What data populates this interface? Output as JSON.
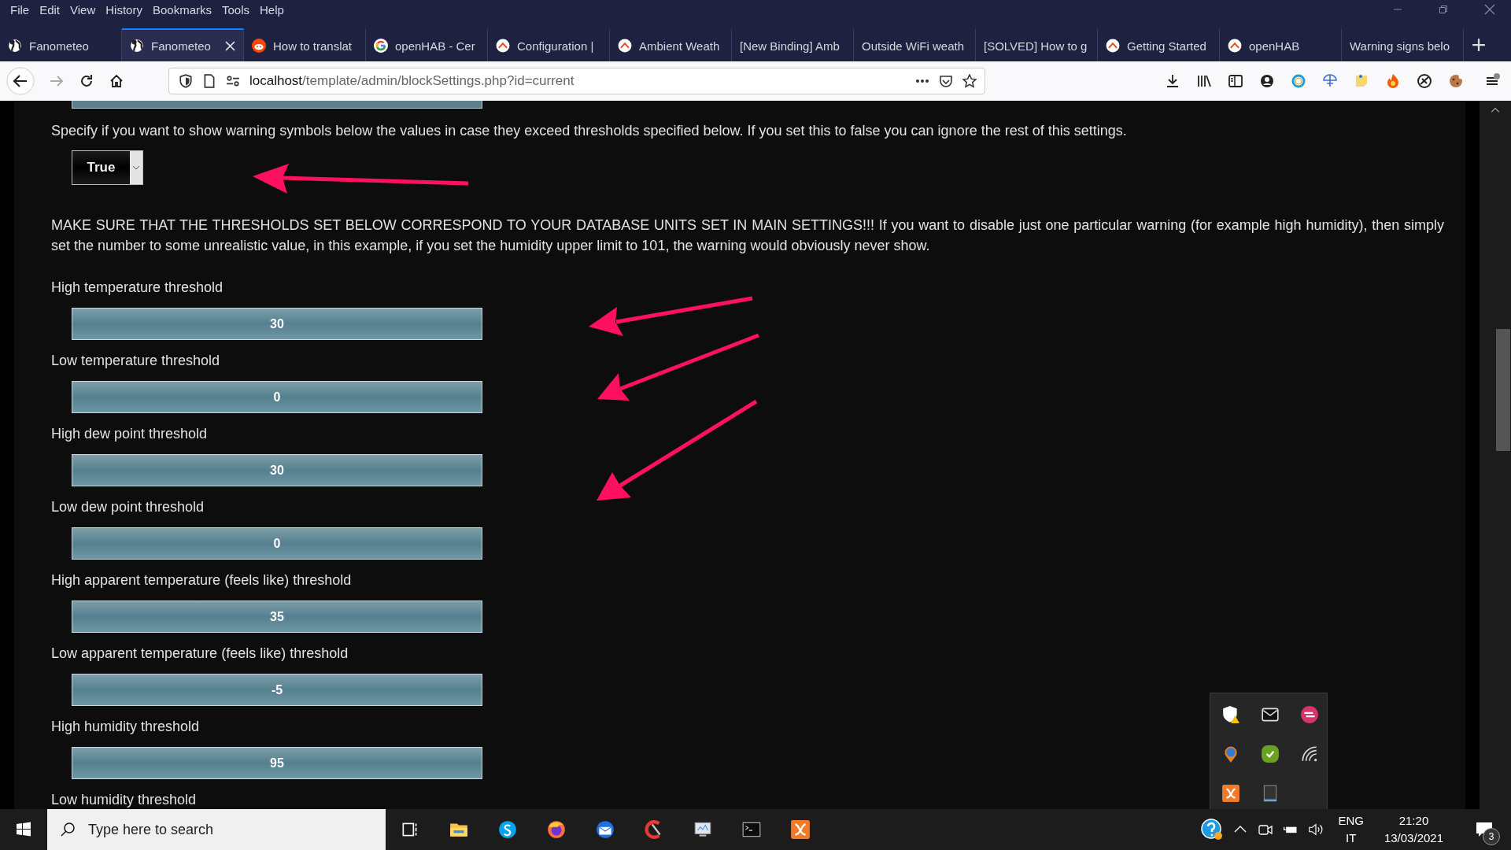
{
  "menu": [
    "File",
    "Edit",
    "View",
    "History",
    "Bookmarks",
    "Tools",
    "Help"
  ],
  "tabs": [
    {
      "title": "Fanometeo",
      "kind": "globe",
      "selected": false
    },
    {
      "title": "Fanometeo",
      "kind": "globe",
      "selected": true
    },
    {
      "title": "How to translat",
      "kind": "reddit",
      "selected": false
    },
    {
      "title": "openHAB - Cer",
      "kind": "google",
      "selected": false
    },
    {
      "title": "Configuration |",
      "kind": "openhab",
      "selected": false
    },
    {
      "title": "Ambient Weath",
      "kind": "openhab",
      "selected": false
    },
    {
      "title": "[New Binding] Amb",
      "kind": "plain",
      "selected": false
    },
    {
      "title": "Outside WiFi weath",
      "kind": "plain",
      "selected": false
    },
    {
      "title": "[SOLVED] How to g",
      "kind": "plain",
      "selected": false
    },
    {
      "title": "Getting Started",
      "kind": "openhab",
      "selected": false
    },
    {
      "title": "openHAB",
      "kind": "openhab",
      "selected": false
    },
    {
      "title": "Warning signs belo",
      "kind": "plain",
      "selected": false
    }
  ],
  "address": {
    "host": "localhost",
    "path": "/template/admin/blockSettings.php?id=current"
  },
  "page": {
    "intro": "Specify if you want to show warning symbols below the values in case they exceed thresholds specified below. If you set this to false you can ignore the rest of this settings.",
    "select": {
      "value": "True"
    },
    "notice": "MAKE SURE THAT THE THRESHOLDS SET BELOW CORRESPOND TO YOUR DATABASE UNITS SET IN MAIN SETTINGS!!! If you want to disable just one particular warning (for example high humidity), then simply set the number to some unrealistic value, in this example, if you set the humidity upper limit to 101, the warning would obviously never show.",
    "fields": [
      {
        "label": "High temperature threshold",
        "value": "30"
      },
      {
        "label": "Low temperature threshold",
        "value": "0"
      },
      {
        "label": "High dew point threshold",
        "value": "30"
      },
      {
        "label": "Low dew point threshold",
        "value": "0"
      },
      {
        "label": "High apparent temperature (feels like) threshold",
        "value": "35"
      },
      {
        "label": "Low apparent temperature (feels like) threshold",
        "value": "-5"
      },
      {
        "label": "High humidity threshold",
        "value": "95"
      }
    ],
    "next_label": "Low humidity threshold"
  },
  "taskbar": {
    "search_placeholder": "Type here to search",
    "language": "ENG",
    "region": "IT",
    "time": "21:20",
    "date": "13/03/2021",
    "notification_count": "3"
  }
}
